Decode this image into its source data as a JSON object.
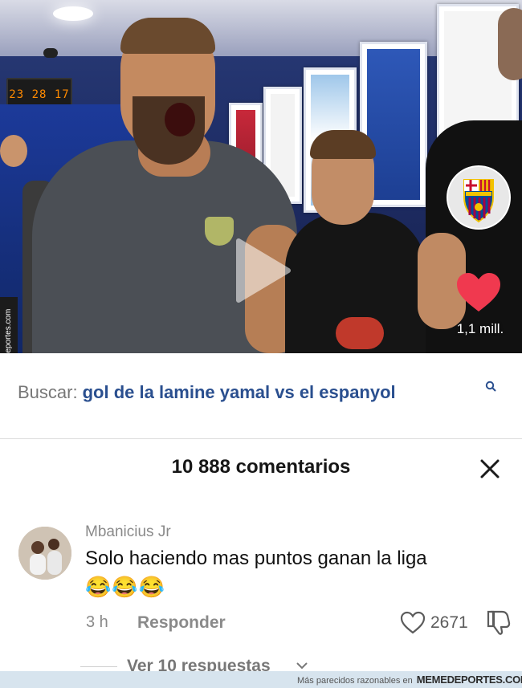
{
  "video": {
    "scoreboard": "23 28 17",
    "like_count": "1,1 mill.",
    "watermark": "Memedeportes.com",
    "club_badge_text": "FCB"
  },
  "search": {
    "label": "Buscar:",
    "query": "gol de la lamine yamal vs el espanyol"
  },
  "comments": {
    "title": "10 888 comentarios",
    "items": [
      {
        "username": "Mbanicius Jr",
        "text": "Solo haciendo mas puntos ganan la liga",
        "emojis": "😂😂😂",
        "time": "3 h",
        "reply_label": "Responder",
        "likes": "2671",
        "view_replies": "Ver 10 respuestas"
      }
    ]
  },
  "footer": {
    "text": "Más parecidos razonables en",
    "brand": "MEMEDEPORTES.COM"
  },
  "colors": {
    "heart": "#f0394f",
    "search_query": "#2a4f8f",
    "barca_blue": "#004d98",
    "barca_red": "#a50044"
  }
}
